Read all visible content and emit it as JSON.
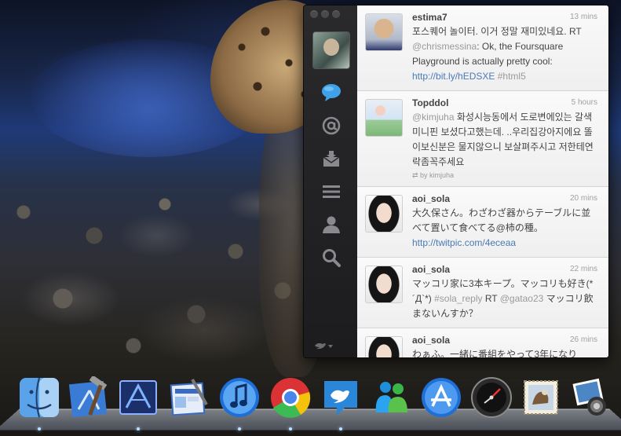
{
  "tweets": [
    {
      "user": "estima7",
      "time": "13 mins",
      "parts": [
        {
          "t": "포스퀘어 놀이터. 이거 정말 재미있네요. RT ",
          "c": "text"
        },
        {
          "t": "@chrismessina",
          "c": "tag"
        },
        {
          "t": ": Ok, the Foursquare Playground is actually pretty cool: ",
          "c": "text"
        },
        {
          "t": "http://bit.ly/hEDSXE",
          "c": "link"
        },
        {
          "t": " ",
          "c": "text"
        },
        {
          "t": "#html5",
          "c": "tag"
        }
      ]
    },
    {
      "user": "Topddol",
      "time": "5 hours",
      "parts": [
        {
          "t": "@kimjuha",
          "c": "tag"
        },
        {
          "t": " 화성시능동에서 도로변에있는 갈색미니핀 보셨다고했는데. ..우리집강아지에요 똘이보신분은 물지않으니 보살펴주시고 저한테연락좀꼭주세요",
          "c": "text"
        }
      ],
      "via": "by kimjuha"
    },
    {
      "user": "aoi_sola",
      "time": "20 mins",
      "parts": [
        {
          "t": "大久保さん。わざわざ器からテーブルに並べて置いて食べてる@柿の種。 ",
          "c": "text"
        },
        {
          "t": "http://twitpic.com/4eceaa",
          "c": "link"
        }
      ]
    },
    {
      "user": "aoi_sola",
      "time": "22 mins",
      "parts": [
        {
          "t": "マッコリ家に3本キープ。マッコリも好き(*´Д`*) ",
          "c": "text"
        },
        {
          "t": "#sola_reply",
          "c": "tag"
        },
        {
          "t": " RT ",
          "c": "text"
        },
        {
          "t": "@gatao23",
          "c": "tag"
        },
        {
          "t": " マッコリ飲まないんすか？",
          "c": "text"
        }
      ]
    },
    {
      "user": "aoi_sola",
      "time": "26 mins",
      "parts": [
        {
          "t": "わぁふ。一緒に番組をやって3年になり",
          "c": "text"
        }
      ]
    }
  ],
  "sidebar": {
    "icons": [
      "timeline-bubble-icon",
      "mentions-at-icon",
      "messages-inbox-icon",
      "lists-icon",
      "profile-person-icon",
      "search-icon"
    ],
    "bottom_icon": "twitter-bird-menu-icon"
  },
  "dock": {
    "icons": [
      "finder-icon",
      "xcode-icon",
      "instruments-icon",
      "interface-builder-icon",
      "itunes-icon",
      "chrome-icon",
      "twitter-icon",
      "messenger-icon",
      "app-store-icon",
      "dashboard-icon",
      "mail-icon",
      "iphoto-icon"
    ]
  },
  "colors": {
    "link": "#4a7ab5",
    "tag": "#9a9a9a",
    "text": "#444444",
    "sidebar": "#1c1c1e",
    "tweet_bg": "#f3f3f3"
  }
}
